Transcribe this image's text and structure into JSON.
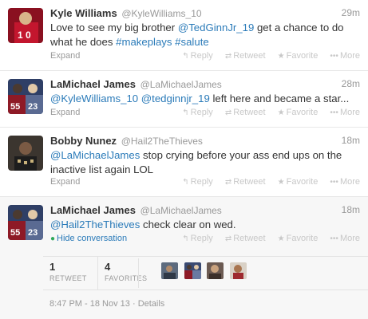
{
  "tweets": [
    {
      "fullname": "Kyle Williams",
      "username": "@KyleWilliams_10",
      "time": "29m",
      "text": [
        {
          "t": "Love to see my big brother "
        },
        {
          "t": "@TedGinnJr_19",
          "link": true
        },
        {
          "t": "  get a chance to do what he does "
        },
        {
          "t": "#makeplays",
          "link": true
        },
        {
          "t": " "
        },
        {
          "t": "#salute",
          "link": true
        }
      ],
      "expand_label": "Expand",
      "avatar_colors": [
        "#b3122a",
        "#e8c9a0"
      ]
    },
    {
      "fullname": "LaMichael James",
      "username": "@LaMichaelJames",
      "time": "28m",
      "text": [
        {
          "t": "@KyleWilliams_10",
          "link": true
        },
        {
          "t": " "
        },
        {
          "t": "@tedginnjr_19",
          "link": true
        },
        {
          "t": " left here and became a star..."
        }
      ],
      "expand_label": "Expand",
      "avatar_colors": [
        "#9c1a26",
        "#3a4a72"
      ]
    },
    {
      "fullname": "Bobby Nunez",
      "username": "@Hail2TheThieves",
      "time": "18m",
      "text": [
        {
          "t": "@LaMichaelJames",
          "link": true
        },
        {
          "t": " stop crying before your ass end ups on the inactive list again LOL"
        }
      ],
      "expand_label": "Expand",
      "avatar_colors": [
        "#2a2a2a",
        "#6d5a4a"
      ]
    },
    {
      "fullname": "LaMichael James",
      "username": "@LaMichaelJames",
      "time": "18m",
      "text": [
        {
          "t": "@Hail2TheThieves",
          "link": true
        },
        {
          "t": " check clear on wed."
        }
      ],
      "hide_label": "Hide conversation",
      "avatar_colors": [
        "#9c1a26",
        "#3a4a72"
      ]
    }
  ],
  "actions": {
    "reply": "Reply",
    "retweet": "Retweet",
    "favorite": "Favorite",
    "more": "More"
  },
  "stats": {
    "retweets": "1",
    "retweets_label": "RETWEET",
    "favorites": "4",
    "favorites_label": "FAVORITES"
  },
  "timestamp": "8:47 PM - 18 Nov 13",
  "details_label": "Details",
  "colors": {
    "link": "#2b7bb9",
    "muted": "#999999",
    "hide_conv_icon": "#2ea85a"
  }
}
